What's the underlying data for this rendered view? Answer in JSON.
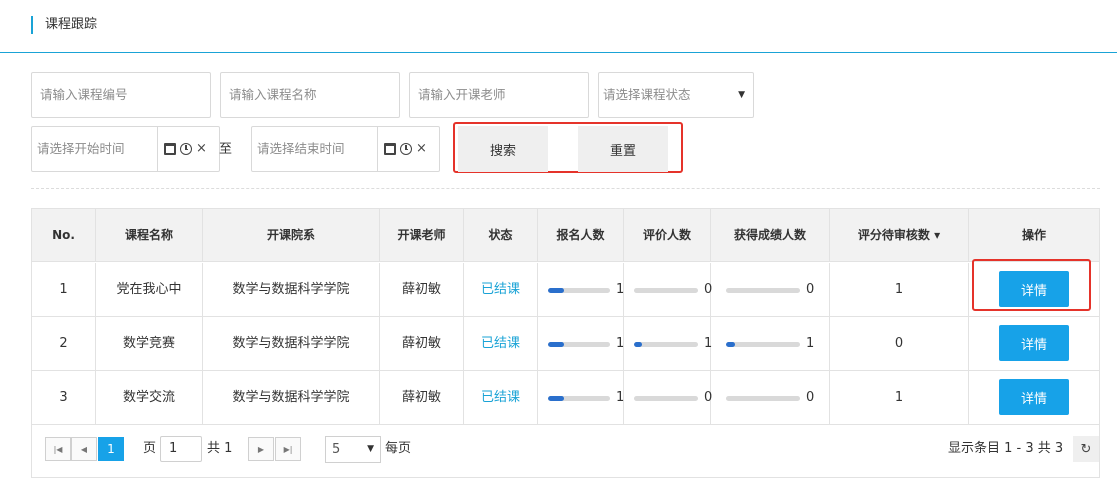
{
  "header": {
    "title": "课程跟踪"
  },
  "filters": {
    "course_no_placeholder": "请输入课程编号",
    "course_name_placeholder": "请输入课程名称",
    "teacher_placeholder": "请输入开课老师",
    "status_placeholder": "请选择课程状态",
    "start_time_placeholder": "请选择开始时间",
    "to_label": "至",
    "end_time_placeholder": "请选择结束时间",
    "search_label": "搜索",
    "reset_label": "重置"
  },
  "table": {
    "columns": [
      "No.",
      "课程名称",
      "开课院系",
      "开课老师",
      "状态",
      "报名人数",
      "评价人数",
      "获得成绩人数",
      "评分待审核数 ▾",
      "操作"
    ],
    "rows": [
      {
        "no": "1",
        "name": "党在我心中",
        "dept": "数学与数据科学学院",
        "teacher": "薛初敏",
        "status": "已结课",
        "enrolled": "1",
        "enrolled_ratio": 0.25,
        "rated": "0",
        "rated_ratio": 0,
        "graded": "0",
        "graded_ratio": 0,
        "pending": "1",
        "action": "详情"
      },
      {
        "no": "2",
        "name": "数学竞赛",
        "dept": "数学与数据科学学院",
        "teacher": "薛初敏",
        "status": "已结课",
        "enrolled": "1",
        "enrolled_ratio": 0.25,
        "rated": "1",
        "rated_ratio": 0.12,
        "graded": "1",
        "graded_ratio": 0.12,
        "pending": "0",
        "action": "详情"
      },
      {
        "no": "3",
        "name": "数学交流",
        "dept": "数学与数据科学学院",
        "teacher": "薛初敏",
        "status": "已结课",
        "enrolled": "1",
        "enrolled_ratio": 0.25,
        "rated": "0",
        "rated_ratio": 0,
        "graded": "0",
        "graded_ratio": 0,
        "pending": "1",
        "action": "详情"
      }
    ]
  },
  "pager": {
    "current_page": "1",
    "page_label": "页",
    "page_input": "1",
    "total_label": "共 1",
    "page_size": "5",
    "per_page_label": "每页",
    "summary": "显示条目 1 - 3 共 3"
  },
  "colors": {
    "accent": "#17a2e8",
    "highlight": "#e5332a",
    "progress": "#2a6fcc"
  },
  "icons": [
    "calendar-icon",
    "clock-icon",
    "clear-icon",
    "dropdown-caret-icon",
    "first-page-icon",
    "prev-page-icon",
    "next-page-icon",
    "last-page-icon",
    "refresh-icon"
  ]
}
